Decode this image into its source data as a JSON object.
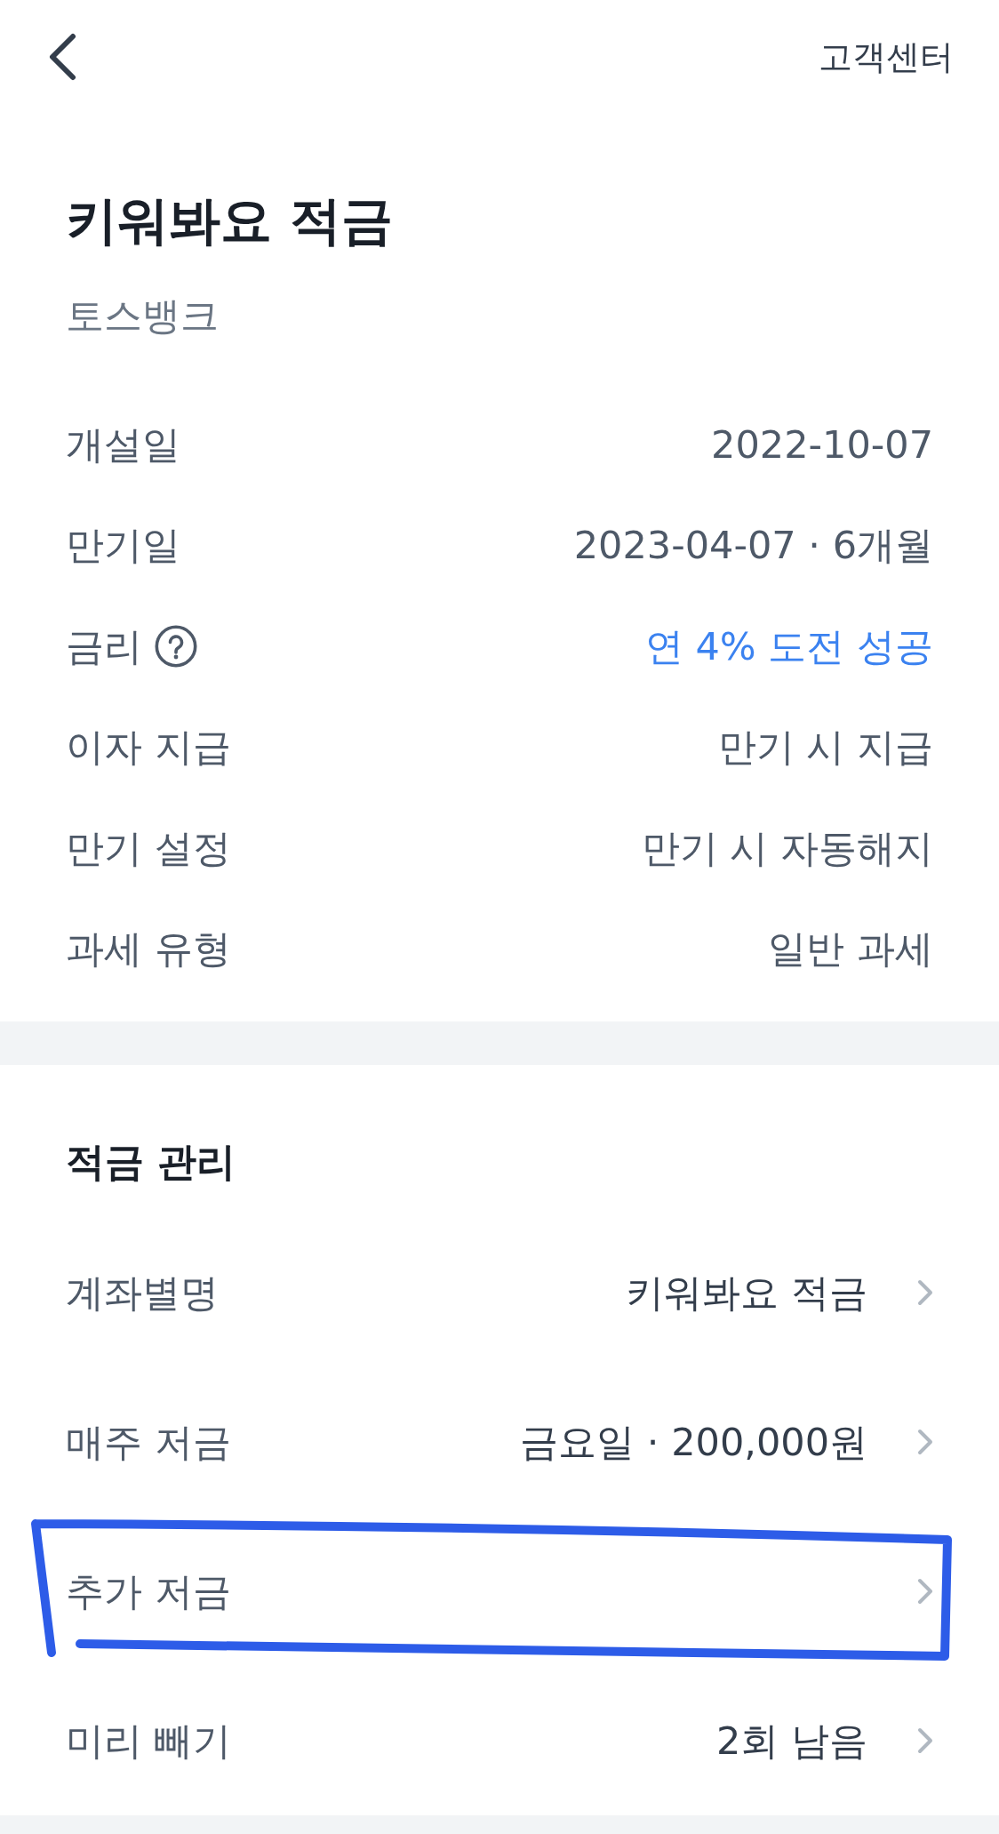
{
  "top_bar": {
    "link": "고객센터"
  },
  "product": {
    "title": "키워봐요 적금",
    "bank": "토스뱅크"
  },
  "details": [
    {
      "label": "개설일",
      "value": "2022-10-07",
      "kind": "plain"
    },
    {
      "label": "만기일",
      "value": "2023-04-07 · 6개월",
      "kind": "plain"
    },
    {
      "label": "금리",
      "value": "연 4% 도전 성공",
      "kind": "help"
    },
    {
      "label": "이자 지급",
      "value": "만기 시 지급",
      "kind": "plain"
    },
    {
      "label": "만기 설정",
      "value": "만기 시 자동해지",
      "kind": "plain"
    },
    {
      "label": "과세 유형",
      "value": "일반 과세",
      "kind": "plain"
    }
  ],
  "management": {
    "title": "적금 관리",
    "items": [
      {
        "label": "계좌별명",
        "value": "키워봐요 적금",
        "highlighted": false
      },
      {
        "label": "매주 저금",
        "value": "금요일 · 200,000원",
        "highlighted": false
      },
      {
        "label": "추가 저금",
        "highlighted": true
      },
      {
        "label": "미리 빼기",
        "value": "2회 남음",
        "highlighted": false
      }
    ]
  }
}
